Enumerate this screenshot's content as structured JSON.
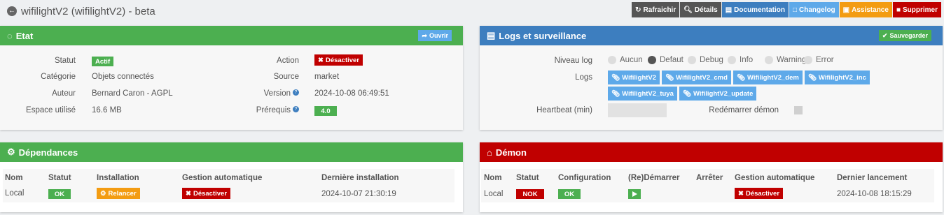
{
  "header": {
    "title": "wifilightV2 (wifilightV2) - beta",
    "buttons": [
      {
        "label": "Rafraichir",
        "icon": "refresh-icon",
        "color": "#555555"
      },
      {
        "label": "Détails",
        "icon": "search-icon",
        "color": "#555555"
      },
      {
        "label": "Documentation",
        "icon": "book-icon",
        "color": "#3d7ebf"
      },
      {
        "label": "Changelog",
        "icon": "file-icon",
        "color": "#5ea9e9"
      },
      {
        "label": "Assistance",
        "icon": "truck-icon",
        "color": "#f39c12"
      },
      {
        "label": "Supprimer",
        "icon": "trash-icon",
        "color": "#c00000"
      }
    ]
  },
  "etat": {
    "title": "Etat",
    "open_label": "Ouvrir",
    "statut_label": "Statut",
    "statut_value": "Actif",
    "categorie_label": "Catégorie",
    "categorie_value": "Objets connectés",
    "auteur_label": "Auteur",
    "auteur_value": "Bernard Caron - AGPL",
    "espace_label": "Espace utilisé",
    "espace_value": "16.6 MB",
    "action_label": "Action",
    "action_value": "Désactiver",
    "source_label": "Source",
    "source_value": "market",
    "version_label": "Version",
    "version_value": "2024-10-08 06:49:51",
    "prerequis_label": "Prérequis",
    "prerequis_value": "4.0"
  },
  "logs": {
    "title": "Logs et surveillance",
    "save_label": "Sauvegarder",
    "niveau_label": "Niveau log",
    "levels": [
      "Aucun",
      "Defaut",
      "Debug",
      "Info",
      "Warning",
      "Error"
    ],
    "selected_level": "Defaut",
    "logs_label": "Logs",
    "log_files": [
      "WifilightV2",
      "WifilightV2_cmd",
      "WifilightV2_dem",
      "WifilightV2_inc",
      "WifilightV2_tuya",
      "WifilightV2_update"
    ],
    "heartbeat_label": "Heartbeat (min)",
    "heartbeat_value": "",
    "restart_label": "Redémarrer démon"
  },
  "dependances": {
    "title": "Dépendances",
    "headers": [
      "Nom",
      "Statut",
      "Installation",
      "Gestion automatique",
      "Dernière installation"
    ],
    "row": {
      "nom": "Local",
      "statut": "OK",
      "installation": "Relancer",
      "gestion": "Désactiver",
      "derniere": "2024-10-07 21:30:19"
    }
  },
  "demon": {
    "title": "Démon",
    "headers": [
      "Nom",
      "Statut",
      "Configuration",
      "(Re)Démarrer",
      "Arrêter",
      "Gestion automatique",
      "Dernier lancement"
    ],
    "row": {
      "nom": "Local",
      "statut": "NOK",
      "configuration": "OK",
      "gestion": "Désactiver",
      "dernier": "2024-10-08 18:15:29"
    }
  }
}
